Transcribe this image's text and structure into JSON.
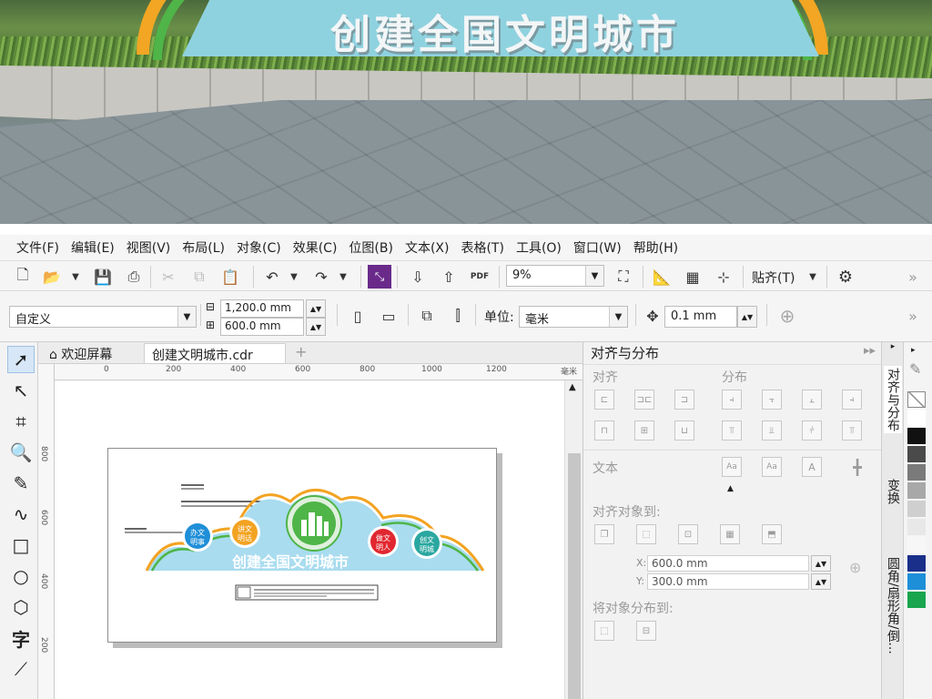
{
  "scene": {
    "sign_text": "创建全国文明城市"
  },
  "menu": [
    "文件(F)",
    "编辑(E)",
    "视图(V)",
    "布局(L)",
    "对象(C)",
    "效果(C)",
    "位图(B)",
    "文本(X)",
    "表格(T)",
    "工具(O)",
    "窗口(W)",
    "帮助(H)"
  ],
  "toolbar1": {
    "zoom": "9%",
    "snap_label": "贴齐(T)"
  },
  "toolbar2": {
    "preset": "自定义",
    "width": "1,200.0 mm",
    "height": "600.0 mm",
    "unit_label": "单位:",
    "unit": "毫米",
    "nudge": "0.1 mm"
  },
  "tabs": {
    "welcome": "欢迎屏幕",
    "document": "创建文明城市.cdr",
    "add": "+"
  },
  "ruler": {
    "h_ticks": [
      "0",
      "200",
      "400",
      "600",
      "800",
      "1000",
      "1200"
    ],
    "v_ticks": [
      "800",
      "600",
      "400",
      "200"
    ],
    "unit": "毫米"
  },
  "artwork": {
    "title": "创建全国文明城市",
    "badges": [
      {
        "text": "办文明事",
        "color": "#1f8fd8"
      },
      {
        "text": "讲文明话",
        "color": "#f3a322"
      },
      {
        "text": "做文明人",
        "color": "#e1272f"
      },
      {
        "text": "创文明城",
        "color": "#2aa7a0"
      }
    ]
  },
  "docker": {
    "title": "对齐与分布",
    "align": "对齐",
    "distribute": "分布",
    "text": "文本",
    "align_to": "对齐对象到:",
    "x": "600.0 mm",
    "y": "300.0 mm",
    "distribute_to": "将对象分布到:"
  },
  "dock_tabs": [
    "对齐与分布",
    "变换",
    "圆角/扇形角/倒..."
  ],
  "palette": [
    "#ffffff",
    "#111111",
    "#4a4a4a",
    "#7a7a7a",
    "#a8a8a8",
    "#cfcfcf",
    "#e8e8e8",
    "#f7f7f7",
    "#1a2f8a",
    "#1d8fd8",
    "#19a44e"
  ]
}
